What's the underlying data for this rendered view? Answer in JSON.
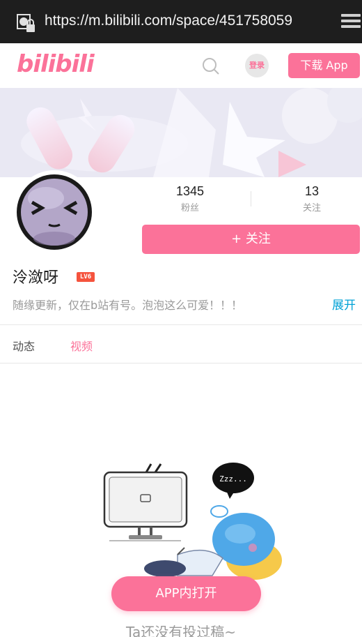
{
  "browser": {
    "url": "https://m.bilibili.com/space/451758059"
  },
  "header": {
    "logo_text": "bilibili",
    "login_label": "登录",
    "download_label": "下载 App",
    "brand_color": "#fb7299"
  },
  "profile": {
    "fans_count": "1345",
    "fans_label": "粉丝",
    "following_count": "13",
    "following_label": "关注",
    "follow_button": "+ 关注",
    "username": "泠潋呀",
    "level": "LV6",
    "bio": "随缘更新，仅在b站有号。泡泡这么可爱！！！",
    "expand_label": "展开"
  },
  "tabs": [
    {
      "label": "动态",
      "active": false
    },
    {
      "label": "视频",
      "active": true
    }
  ],
  "content": {
    "open_app_button": "APP内打开",
    "empty_message": "Ta还没有投过稿~",
    "illustration_bubble": "Zzz..."
  },
  "icons": [
    "lock-icon",
    "menu-icon",
    "search-icon"
  ]
}
